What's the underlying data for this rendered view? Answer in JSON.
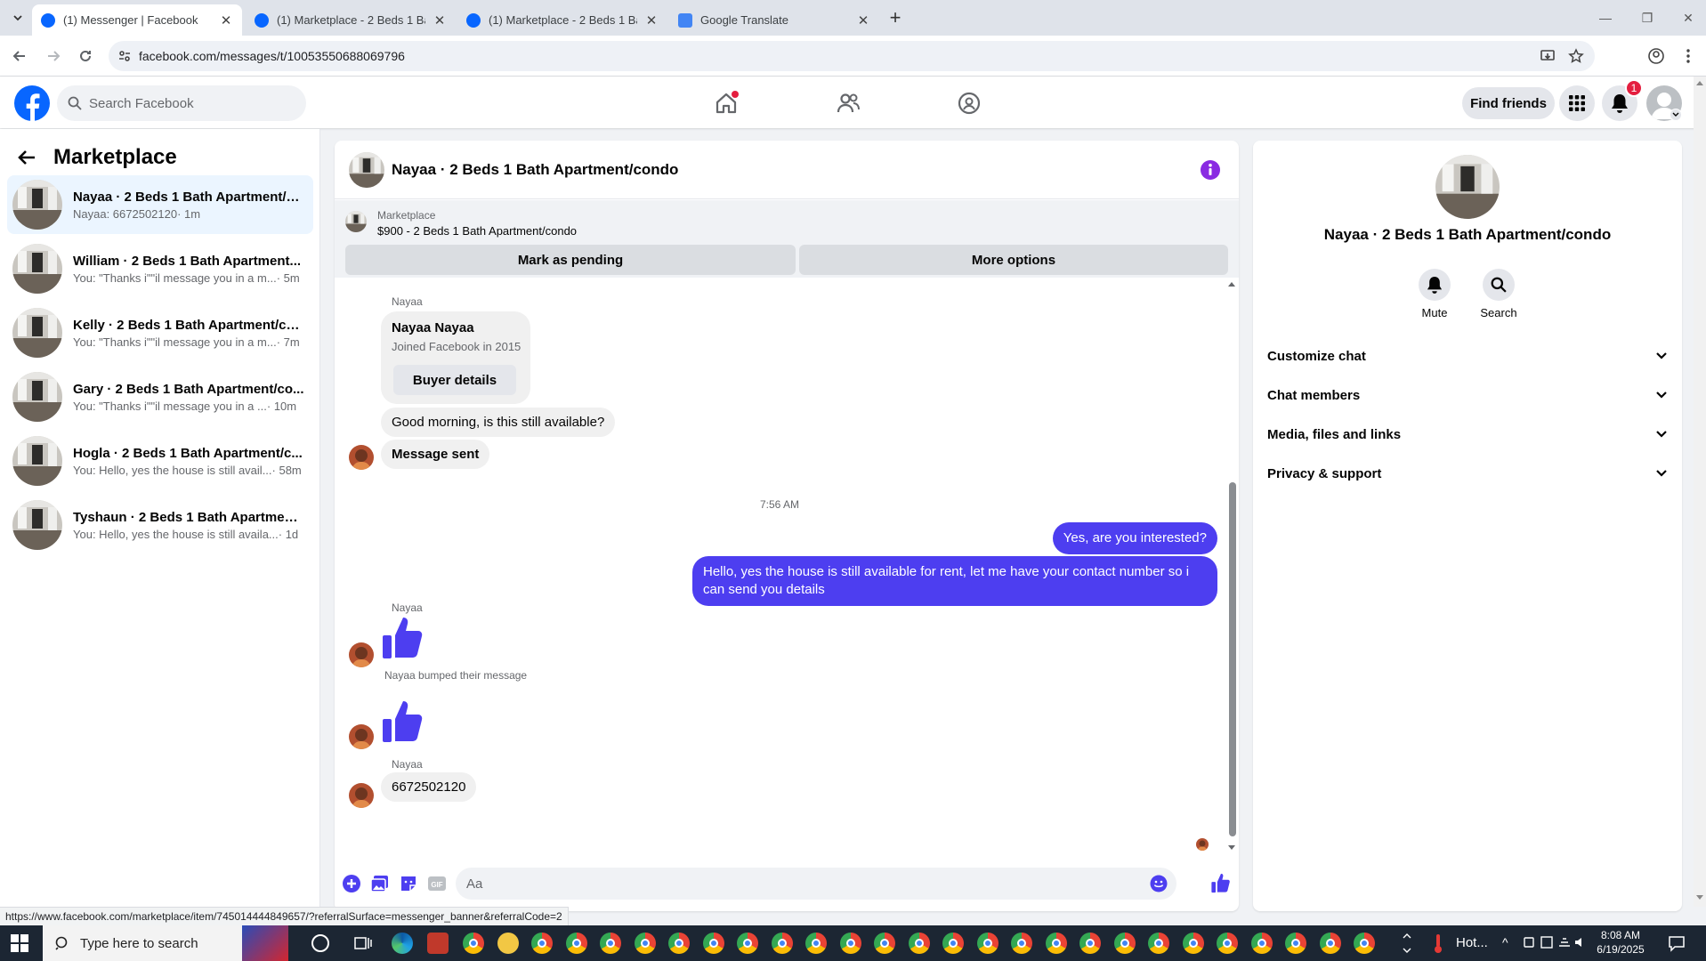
{
  "browser": {
    "tabs": [
      {
        "title": "(1) Messenger | Facebook",
        "active": true
      },
      {
        "title": "(1) Marketplace - 2 Beds 1 Bath",
        "active": false
      },
      {
        "title": "(1) Marketplace - 2 Beds 1 Bath",
        "active": false
      },
      {
        "title": "Google Translate",
        "active": false
      }
    ],
    "url": "facebook.com/messages/t/10053550688069796",
    "status_url": "https://www.facebook.com/marketplace/item/745014444849657/?referralSurface=messenger_banner&referralCode=2"
  },
  "fb": {
    "search_placeholder": "Search Facebook",
    "find_friends": "Find friends",
    "notification_count": "1",
    "brand_color": "#0866ff"
  },
  "sidebar": {
    "title": "Marketplace",
    "conversations": [
      {
        "name": "Nayaa · 2 Beds 1 Bath Apartment/c...",
        "preview": "Nayaa: 6672502120",
        "time": "· 1m",
        "active": true
      },
      {
        "name": "William · 2 Beds 1 Bath Apartment...",
        "preview": "You: \"Thanks i\"\"il message you in a m...",
        "time": "· 5m",
        "active": false
      },
      {
        "name": "Kelly · 2 Beds 1 Bath Apartment/co...",
        "preview": "You: \"Thanks i\"\"il message you in a m...",
        "time": "· 7m",
        "active": false
      },
      {
        "name": "Gary · 2 Beds 1 Bath Apartment/co...",
        "preview": "You: \"Thanks i\"\"il message you in a ...",
        "time": "· 10m",
        "active": false
      },
      {
        "name": "Hogla · 2 Beds 1 Bath Apartment/c...",
        "preview": "You: Hello, yes the house is still avail...",
        "time": "· 58m",
        "active": false
      },
      {
        "name": "Tyshaun · 2 Beds 1 Bath Apartment...",
        "preview": "You: Hello, yes the house is still availa...",
        "time": "· 1d",
        "active": false
      }
    ]
  },
  "chat": {
    "title": "Nayaa · 2 Beds 1 Bath Apartment/condo",
    "marketplace_label": "Marketplace",
    "listing": "$900 - 2 Beds 1 Bath Apartment/condo",
    "mark_pending": "Mark as pending",
    "more_options": "More options",
    "accent": "#4d3ef0",
    "messages": {
      "sender1": "Nayaa",
      "card_name": "Nayaa Nayaa",
      "card_joined": "Joined Facebook in 2015",
      "buyer_details": "Buyer details",
      "msg1": "Good morning, is this still available?",
      "msg2": "Message sent",
      "timestamp": "7:56 AM",
      "out1": "Yes, are you interested?",
      "out2": "Hello, yes the house is still available for rent, let me have your contact number so i can send you details",
      "sender2": "Nayaa",
      "bumped": "Nayaa bumped their message",
      "sender3": "Nayaa",
      "msg3": "6672502120"
    },
    "composer_placeholder": "Aa"
  },
  "details": {
    "name": "Nayaa · 2 Beds 1 Bath Apartment/condo",
    "mute": "Mute",
    "search": "Search",
    "sections": [
      "Customize chat",
      "Chat members",
      "Media, files and links",
      "Privacy & support"
    ]
  },
  "taskbar": {
    "search_placeholder": "Type here to search",
    "weather": "Hot...",
    "time": "8:08 AM",
    "date": "6/19/2025"
  }
}
